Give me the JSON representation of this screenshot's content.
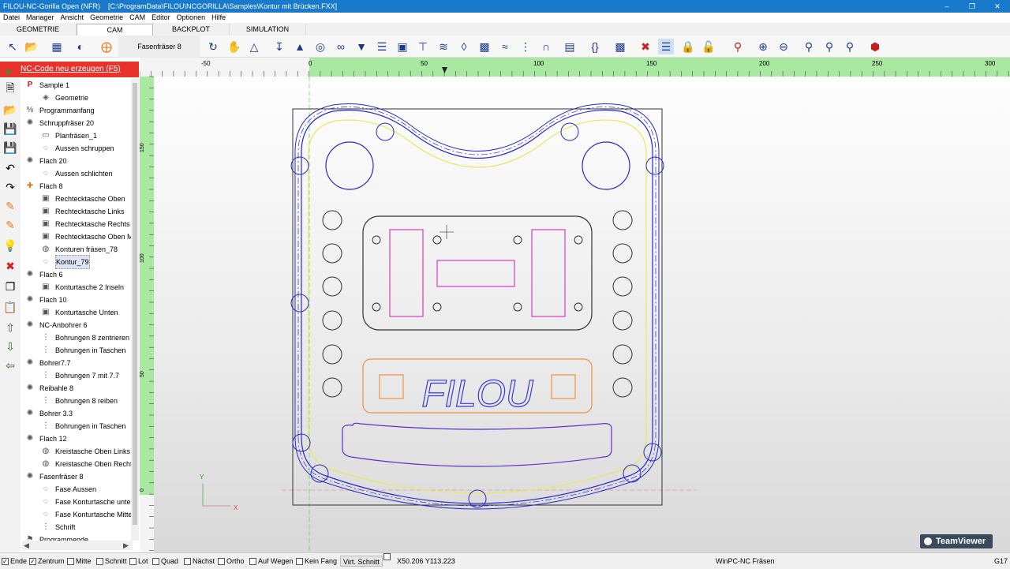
{
  "window": {
    "app_title": "FILOU-NC-Gorilla Open (NFR)",
    "file_path": "[C:\\ProgramData\\FILOU\\NCGORILLA\\Samples\\Kontur mit Brücken.FXX]"
  },
  "menu": [
    "Datei",
    "Manager",
    "Ansicht",
    "Geometrie",
    "CAM",
    "Editor",
    "Optionen",
    "Hilfe"
  ],
  "tabs": [
    {
      "label": "GEOMETRIE",
      "active": false
    },
    {
      "label": "CAM",
      "active": true
    },
    {
      "label": "BACKPLOT",
      "active": false
    },
    {
      "label": "SIMULATION",
      "active": false
    }
  ],
  "toolbar": {
    "current_tool": "Fasenfräser 8",
    "icons": [
      "select-icon",
      "open-icon",
      "pp-icon",
      "compass-icon",
      "tool-icon"
    ]
  },
  "nc_button": "NC-Code neu erzeugen (F5)",
  "tree": [
    {
      "label": "Sample 1",
      "level": 0,
      "icon": "P"
    },
    {
      "label": "Geometrie",
      "level": 1,
      "icon": "◈"
    },
    {
      "label": "Programmanfang",
      "level": 0,
      "icon": "%"
    },
    {
      "label": "Schruppfräser 20",
      "level": 0,
      "icon": "✺"
    },
    {
      "label": "Planfräsen_1",
      "level": 1,
      "icon": "▭"
    },
    {
      "label": "Aussen schruppen",
      "level": 1,
      "icon": "◌"
    },
    {
      "label": "Flach 20",
      "level": 0,
      "icon": "✺"
    },
    {
      "label": "Aussen schlichten",
      "level": 1,
      "icon": "◌"
    },
    {
      "label": "Flach 8",
      "level": 0,
      "icon": "✚"
    },
    {
      "label": "Rechtecktasche Oben",
      "level": 1,
      "icon": "▣"
    },
    {
      "label": "Rechtecktasche Links",
      "level": 1,
      "icon": "▣"
    },
    {
      "label": "Rechtecktasche Rechts",
      "level": 1,
      "icon": "▣"
    },
    {
      "label": "Rechtecktasche Oben Mi",
      "level": 1,
      "icon": "▣"
    },
    {
      "label": "Konturen fräsen_78",
      "level": 1,
      "icon": "◍"
    },
    {
      "label": "Kontur_79",
      "level": 1,
      "icon": "◌",
      "selected": true
    },
    {
      "label": "Flach 6",
      "level": 0,
      "icon": "✺"
    },
    {
      "label": "Konturtasche 2 Inseln",
      "level": 1,
      "icon": "▣"
    },
    {
      "label": "Flach 10",
      "level": 0,
      "icon": "✺"
    },
    {
      "label": "Konturtasche Unten",
      "level": 1,
      "icon": "▣"
    },
    {
      "label": "NC-Anbohrer 6",
      "level": 0,
      "icon": "✺"
    },
    {
      "label": "Bohrungen 8 zentrieren",
      "level": 1,
      "icon": "⋮"
    },
    {
      "label": "Bohrungen in Taschen",
      "level": 1,
      "icon": "⋮"
    },
    {
      "label": "Bohrer7.7",
      "level": 0,
      "icon": "✺"
    },
    {
      "label": "Bohrungen 7 mit 7.7",
      "level": 1,
      "icon": "⋮"
    },
    {
      "label": "Reibahle 8",
      "level": 0,
      "icon": "✺"
    },
    {
      "label": "Bohrungen 8 reiben",
      "level": 1,
      "icon": "⋮"
    },
    {
      "label": "Bohrer 3.3",
      "level": 0,
      "icon": "✺"
    },
    {
      "label": "Bohrungen in Taschen",
      "level": 1,
      "icon": "⋮"
    },
    {
      "label": "Flach 12",
      "level": 0,
      "icon": "✺"
    },
    {
      "label": "Kreistasche Oben Links",
      "level": 1,
      "icon": "◍"
    },
    {
      "label": "Kreistasche Oben Rechts",
      "level": 1,
      "icon": "◍"
    },
    {
      "label": "Fasenfräser 8",
      "level": 0,
      "icon": "✺"
    },
    {
      "label": "Fase Aussen",
      "level": 1,
      "icon": "◌"
    },
    {
      "label": "Fase Konturtasche unten",
      "level": 1,
      "icon": "◌"
    },
    {
      "label": "Fase Konturtasche Mitte",
      "level": 1,
      "icon": "◌"
    },
    {
      "label": "Schrift",
      "level": 1,
      "icon": "⋮"
    },
    {
      "label": "Programmende",
      "level": 0,
      "icon": "⚑"
    }
  ],
  "ruler": {
    "top_labels": [
      "-50",
      "0",
      "50",
      "100",
      "150",
      "200",
      "250",
      "300"
    ],
    "left_labels": [
      "150",
      "100",
      "50",
      "0"
    ]
  },
  "drawing": {
    "text": "FILOU",
    "axis_y": "Y",
    "axis_x": "X"
  },
  "status": {
    "checks": [
      {
        "label": "Ende",
        "checked": true
      },
      {
        "label": "Zentrum",
        "checked": true
      },
      {
        "label": "Mitte",
        "checked": false
      },
      {
        "label": "Schnitt",
        "checked": false
      },
      {
        "label": "Lot",
        "checked": false
      },
      {
        "label": "Quad",
        "checked": false
      },
      {
        "label": "Nächst",
        "checked": false
      },
      {
        "label": "Ortho",
        "checked": false
      },
      {
        "label": "Auf Wegen",
        "checked": false
      },
      {
        "label": "Kein Fang",
        "checked": false
      }
    ],
    "virt_button": "Virt. Schnitt",
    "coords": "X50.206 Y113.223",
    "mode": "WinPC-NC Fräsen",
    "gcode": "G17"
  },
  "overlay": {
    "teamviewer": "TeamViewer"
  },
  "colors": {
    "titlebar": "#1979ca",
    "nc_button": "#e8322c",
    "ruler": "#a8e8a0",
    "contour_blue": "#2a2acc",
    "yellow": "#e8e860",
    "magenta": "#d838c8",
    "orange": "#f09040"
  }
}
